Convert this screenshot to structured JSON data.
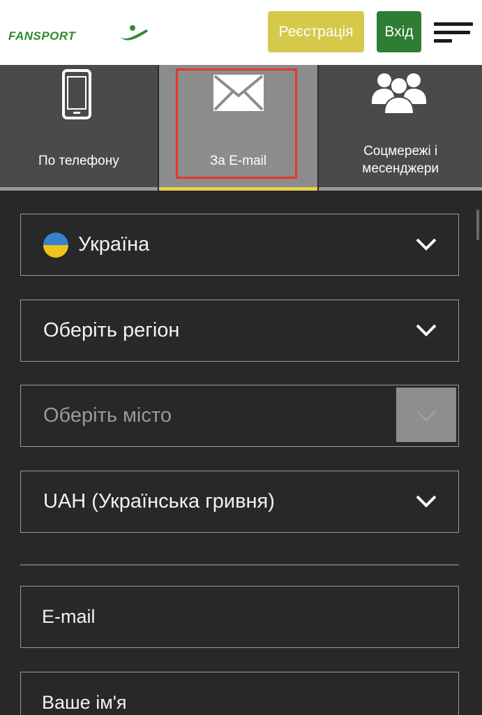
{
  "header": {
    "logo_text": "FANSPORT",
    "register_label": "Реєстрація",
    "login_label": "Вхід",
    "colors": {
      "register": "#d4c94a",
      "login": "#2f7d32",
      "logo": "#2e8b2e"
    }
  },
  "tabs": [
    {
      "label": "По телефону",
      "icon": "phone-icon",
      "active": false
    },
    {
      "label": "За E-mail",
      "icon": "envelope-icon",
      "active": true
    },
    {
      "label": "Соцмережі і месенджери",
      "icon": "users-icon",
      "active": false
    }
  ],
  "form": {
    "country": {
      "value": "Україна",
      "flag": "ukraine-flag-icon"
    },
    "region": {
      "value": "Оберіть регіон"
    },
    "city": {
      "placeholder": "Оберіть місто",
      "disabled": true
    },
    "currency": {
      "value": "UAH (Українська гривня)"
    },
    "email": {
      "placeholder": "E-mail"
    },
    "name": {
      "placeholder": "Ваше ім'я"
    }
  },
  "colors": {
    "background": "#282828",
    "active_tab_underline": "#e6d24a",
    "selection_highlight": "#e8352a"
  }
}
